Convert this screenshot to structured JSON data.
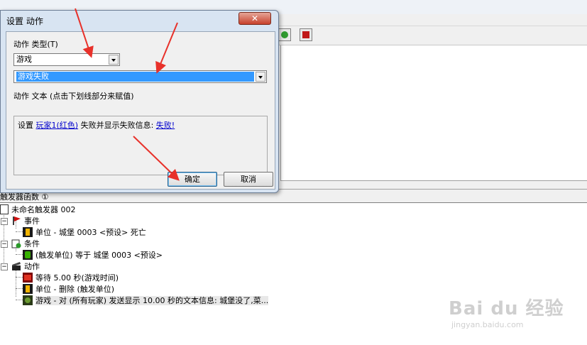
{
  "dialog": {
    "title": "设置 动作",
    "close_glyph": "✕",
    "action_type_label": "动作 类型(T)",
    "category_value": "游戏",
    "action_value": "游戏失败",
    "action_text_label": "动作 文本 (点击下划线部分来赋值)",
    "text_parts": {
      "prefix": "设置 ",
      "player_link": "玩家1(红色)",
      "middle": " 失败并显示失败信息: ",
      "message_link": "失败!"
    },
    "ok_label": "确定",
    "cancel_label": "取消"
  },
  "editor": {
    "split_label": "触发器函数 ①",
    "toolbar_icons": [
      "trigger-green-icon",
      "trigger-red-icon"
    ]
  },
  "tree": {
    "root": "未命名触发器 002",
    "events_label": "事件",
    "event_item": "单位 - 城堡 0003 <预设> 死亡",
    "conditions_label": "条件",
    "condition_item": "(触发单位) 等于 城堡 0003 <预设>",
    "actions_label": "动作",
    "action_items": [
      "等待 5.00 秒(游戏时间)",
      "单位 - 删除 (触发单位)",
      "游戏 - 对 (所有玩家) 发送显示 10.00 秒的文本信息: 城堡没了,菜..."
    ],
    "expander_glyph": "−"
  },
  "watermark": {
    "logo": "Bai du 经验",
    "url": "jingyan.baidu.com"
  },
  "colors": {
    "selection": "#3399ff",
    "link": "#0000cc",
    "arrow": "#e8312a",
    "dialog_frame": "#d8e4f2"
  }
}
